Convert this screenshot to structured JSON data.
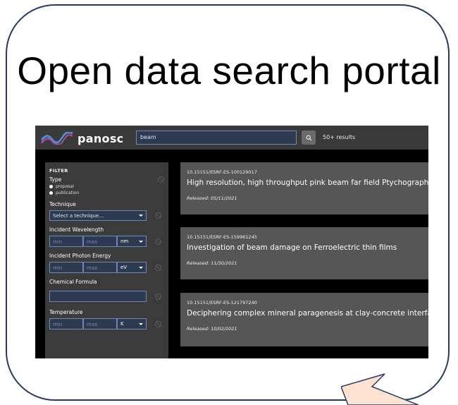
{
  "slide": {
    "title": "Open data search portal"
  },
  "app": {
    "logo_text": "panosc",
    "search": {
      "value": "beam"
    },
    "results_count": "50+ results"
  },
  "filter": {
    "heading": "FILTER",
    "type_label": "Type",
    "type_options": [
      "proposal",
      "publication"
    ],
    "technique_label": "Technique",
    "technique_select": "Select a technique...",
    "wavelength_label": "Incident Wavelength",
    "wavelength": {
      "min_placeholder": "min",
      "max_placeholder": "max",
      "unit": "nm"
    },
    "photon_label": "Incident Photon Energy",
    "photon": {
      "min_placeholder": "min",
      "max_placeholder": "max",
      "unit": "eV"
    },
    "formula_label": "Chemical Formula",
    "temperature_label": "Temperature",
    "temperature": {
      "min_placeholder": "min",
      "max_placeholder": "max",
      "unit": "K"
    }
  },
  "results": [
    {
      "doi": "10.15151/ESRF-ES-100129017",
      "title": "High resolution, high throughput pink beam far field Ptychography",
      "released": "Released: 05/11/2021"
    },
    {
      "doi": "10.15151/ESRF-ES-159961245",
      "title": "Investigation of beam damage on Ferroelectric thin films",
      "released": "Released: 11/30/2021"
    },
    {
      "doi": "10.15151/ESRF-ES-121797240",
      "title": "Deciphering complex mineral paragenesis at clay-concrete interface",
      "released": "Released: 10/02/2021"
    }
  ],
  "colors": {
    "bubble_border": "#243b66",
    "tail_fill": "#fde3cf",
    "tail_border": "#243b66",
    "input_border": "#6f86b8"
  }
}
